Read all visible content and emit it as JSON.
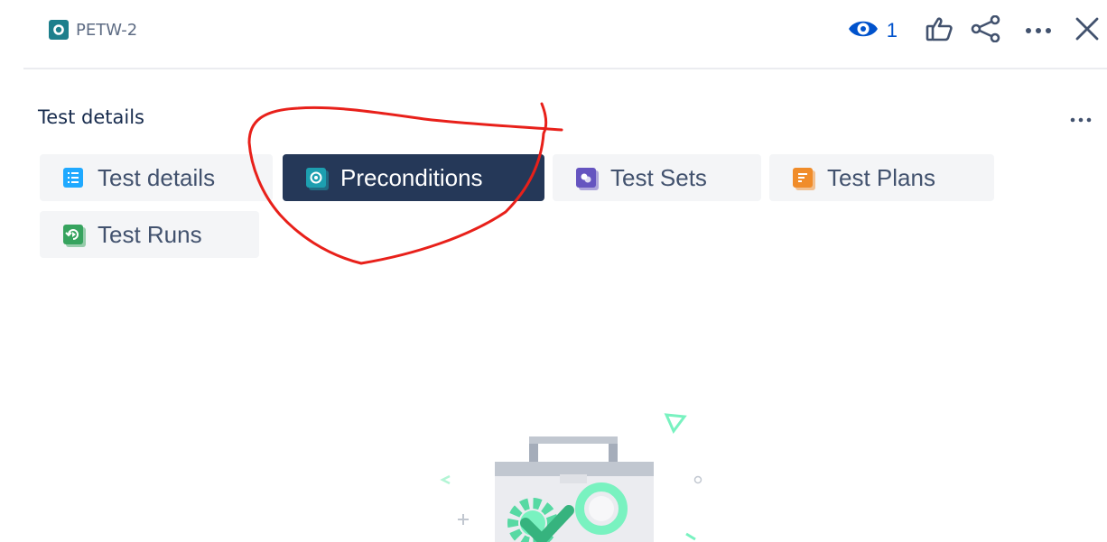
{
  "header": {
    "issue_key": "PETW-2",
    "issue_icon": "precondition-issue-icon",
    "watch_count": "1",
    "watch_icon": "eye-icon",
    "like_icon": "thumbs-up-icon",
    "share_icon": "share-icon",
    "more_icon": "more-horizontal-icon",
    "close_icon": "close-icon"
  },
  "section": {
    "title": "Test details",
    "more_icon": "more-horizontal-icon"
  },
  "tabs": [
    {
      "label": "Test details",
      "icon": "list-icon",
      "color": "#1fa9ff",
      "active": false
    },
    {
      "label": "Preconditions",
      "icon": "precondition-icon",
      "color": "#1d9fb0",
      "active": true
    },
    {
      "label": "Test Sets",
      "icon": "test-set-icon",
      "color": "#6554c0",
      "active": false
    },
    {
      "label": "Test Plans",
      "icon": "test-plan-icon",
      "color": "#f08c2a",
      "active": false
    },
    {
      "label": "Test Runs",
      "icon": "test-run-icon",
      "color": "#36a35e",
      "active": false
    }
  ],
  "colors": {
    "active_tab_bg": "#253858",
    "inactive_tab_bg": "#f4f5f7",
    "annotation": "#e8201a",
    "link_blue": "#0052cc"
  },
  "empty_state": {
    "illustration": "toolbox-with-gear-and-magnifier-illustration"
  }
}
